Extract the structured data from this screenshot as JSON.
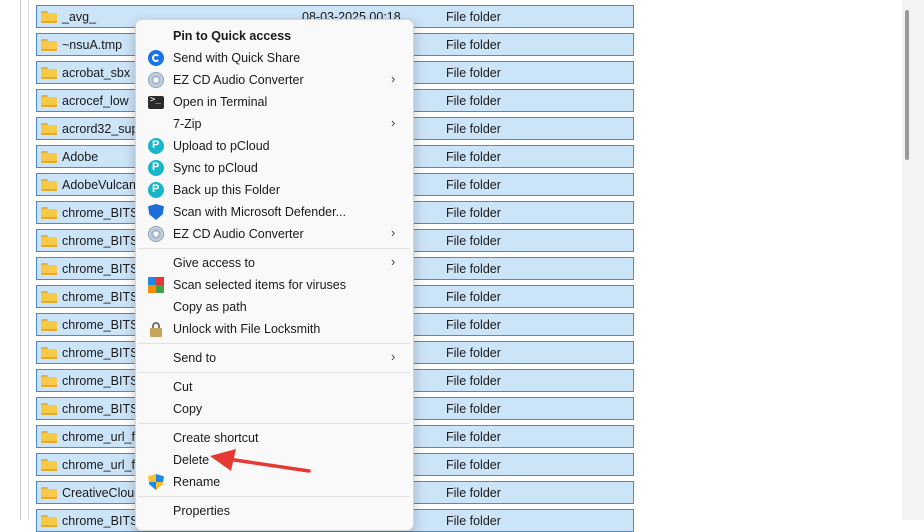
{
  "files": [
    {
      "name": "_avg_",
      "date": "08-03-2025 00:18",
      "type": "File folder"
    },
    {
      "name": "~nsuA.tmp",
      "type": "File folder"
    },
    {
      "name": "acrobat_sbx",
      "type": "File folder"
    },
    {
      "name": "acrocef_low",
      "type": "File folder"
    },
    {
      "name": "acrord32_supe",
      "type": "File folder"
    },
    {
      "name": "Adobe",
      "type": "File folder"
    },
    {
      "name": "AdobeVulcan",
      "type": "File folder"
    },
    {
      "name": "chrome_BITS_",
      "type": "File folder"
    },
    {
      "name": "chrome_BITS_",
      "type": "File folder"
    },
    {
      "name": "chrome_BITS_",
      "type": "File folder"
    },
    {
      "name": "chrome_BITS_",
      "type": "File folder"
    },
    {
      "name": "chrome_BITS_",
      "type": "File folder"
    },
    {
      "name": "chrome_BITS_",
      "type": "File folder"
    },
    {
      "name": "chrome_BITS_",
      "type": "File folder"
    },
    {
      "name": "chrome_BITS_",
      "type": "File folder"
    },
    {
      "name": "chrome_url_fe",
      "type": "File folder"
    },
    {
      "name": "chrome_url_fe",
      "type": "File folder"
    },
    {
      "name": "CreativeCloud",
      "type": "File folder"
    },
    {
      "name": "chrome_BITS_",
      "type": "File folder"
    }
  ],
  "menu": {
    "pin_quick_access": "Pin to Quick access",
    "send_quick_share": "Send with Quick Share",
    "ez_cd_1": "EZ CD Audio Converter",
    "open_terminal": "Open in Terminal",
    "seven_zip": "7-Zip",
    "upload_pcloud": "Upload to pCloud",
    "sync_pcloud": "Sync to pCloud",
    "backup_folder": "Back up this Folder",
    "scan_defender": "Scan with Microsoft Defender...",
    "ez_cd_2": "EZ CD Audio Converter",
    "give_access": "Give access to",
    "scan_viruses": "Scan selected items for viruses",
    "copy_path": "Copy as path",
    "unlock_locksmith": "Unlock with File Locksmith",
    "send_to": "Send to",
    "cut": "Cut",
    "copy": "Copy",
    "create_shortcut": "Create shortcut",
    "delete": "Delete",
    "rename": "Rename",
    "properties": "Properties",
    "submenu_chevron": "›"
  },
  "colors": {
    "selection_bg": "#cce4f7",
    "selection_border": "#4a8ad0",
    "annotation_arrow": "#e53935"
  }
}
